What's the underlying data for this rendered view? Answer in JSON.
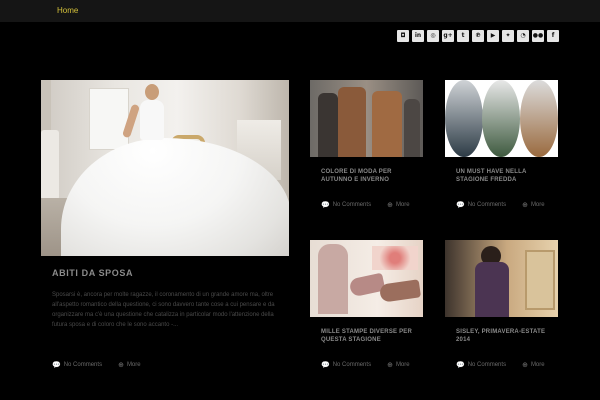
{
  "nav": {
    "home_label": "Home"
  },
  "social": [
    {
      "icon": "instagram-icon",
      "glyph": "◘"
    },
    {
      "icon": "linkedin-icon",
      "glyph": "in"
    },
    {
      "icon": "dribbble-icon",
      "glyph": "◎"
    },
    {
      "icon": "google-plus-icon",
      "glyph": "g+"
    },
    {
      "icon": "tumblr-icon",
      "glyph": "t"
    },
    {
      "icon": "pinterest-icon",
      "glyph": "℗"
    },
    {
      "icon": "youtube-icon",
      "glyph": "▶"
    },
    {
      "icon": "twitter-icon",
      "glyph": "✦"
    },
    {
      "icon": "rss-icon",
      "glyph": "◔"
    },
    {
      "icon": "flickr-icon",
      "glyph": "●●"
    },
    {
      "icon": "facebook-icon",
      "glyph": "f"
    }
  ],
  "featured": {
    "title": "ABITI DA SPOSA",
    "excerpt": "Sposarsi è, ancora per molte ragazze, il coronamento di un grande amore ma, oltre all'aspetto romantico della questione, ci sono davvero tante cose a cui pensare e da organizzare ma c'è una questione che catalizza in particolar modo l'attenzione della futura sposa e di coloro che le sono accanto -...",
    "comments": "No Comments",
    "more": "More"
  },
  "posts": [
    {
      "title": "COLORE DI MODA PER AUTUNNO E INVERNO",
      "comments": "No Comments",
      "more": "More"
    },
    {
      "title": "UN MUST HAVE NELLA STAGIONE FREDDA",
      "comments": "No Comments",
      "more": "More"
    },
    {
      "title": "MILLE STAMPE DIVERSE PER QUESTA STAGIONE",
      "comments": "No Comments",
      "more": "More"
    },
    {
      "title": "SISLEY, PRIMAVERA-ESTATE 2014",
      "comments": "No Comments",
      "more": "More"
    }
  ],
  "colors": {
    "accent": "#d4c13a",
    "background": "#000000",
    "topbar": "#151515"
  }
}
